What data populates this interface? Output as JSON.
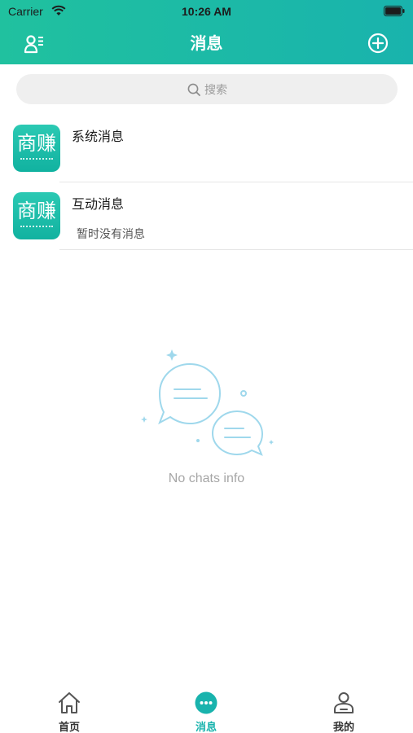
{
  "status_bar": {
    "carrier": "Carrier",
    "time": "10:26 AM",
    "icons": [
      "wifi-icon",
      "battery-icon"
    ]
  },
  "nav": {
    "title": "消息",
    "left_icon": "contacts-icon",
    "right_icon": "add-circle-icon"
  },
  "search": {
    "placeholder": "搜索",
    "icon": "search-icon"
  },
  "conversations": [
    {
      "avatar_text": "商赚",
      "title": "系统消息",
      "preview": ""
    },
    {
      "avatar_text": "商赚",
      "title": "互动消息",
      "preview": "暂时没有消息"
    }
  ],
  "empty_state": {
    "icon": "chat-bubbles-icon",
    "text": "No chats info"
  },
  "tabs": [
    {
      "label": "首页",
      "icon": "home-icon",
      "active": false
    },
    {
      "label": "消息",
      "icon": "message-dots-icon",
      "active": true
    },
    {
      "label": "我的",
      "icon": "user-icon",
      "active": false
    }
  ],
  "colors": {
    "primary": "#19b3ad",
    "header_start": "#20c19f",
    "header_end": "#19b3ad",
    "empty_icon": "#9fd8ec",
    "text_muted": "#a6a6a6"
  }
}
